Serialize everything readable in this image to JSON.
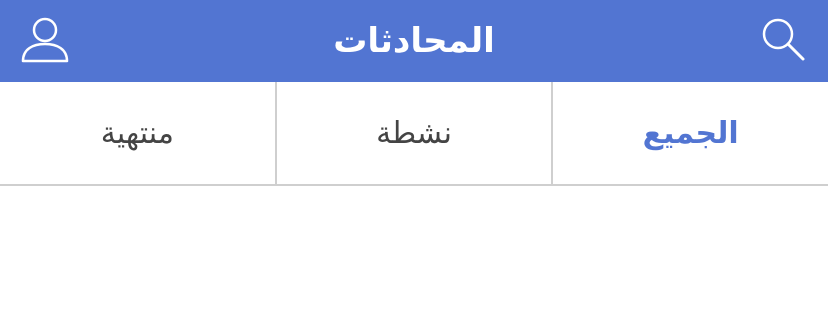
{
  "header": {
    "title": "المحادثات",
    "search_icon": "search-icon",
    "profile_icon": "user-profile-icon",
    "color": "#5275d2"
  },
  "tabs": [
    {
      "label": "منتهية",
      "active": false
    },
    {
      "label": "نشطة",
      "active": false
    },
    {
      "label": "الجميع",
      "active": true
    }
  ],
  "colors": {
    "accent": "#5275d2",
    "tab_text": "#444444",
    "divider": "#cfcfcf"
  }
}
